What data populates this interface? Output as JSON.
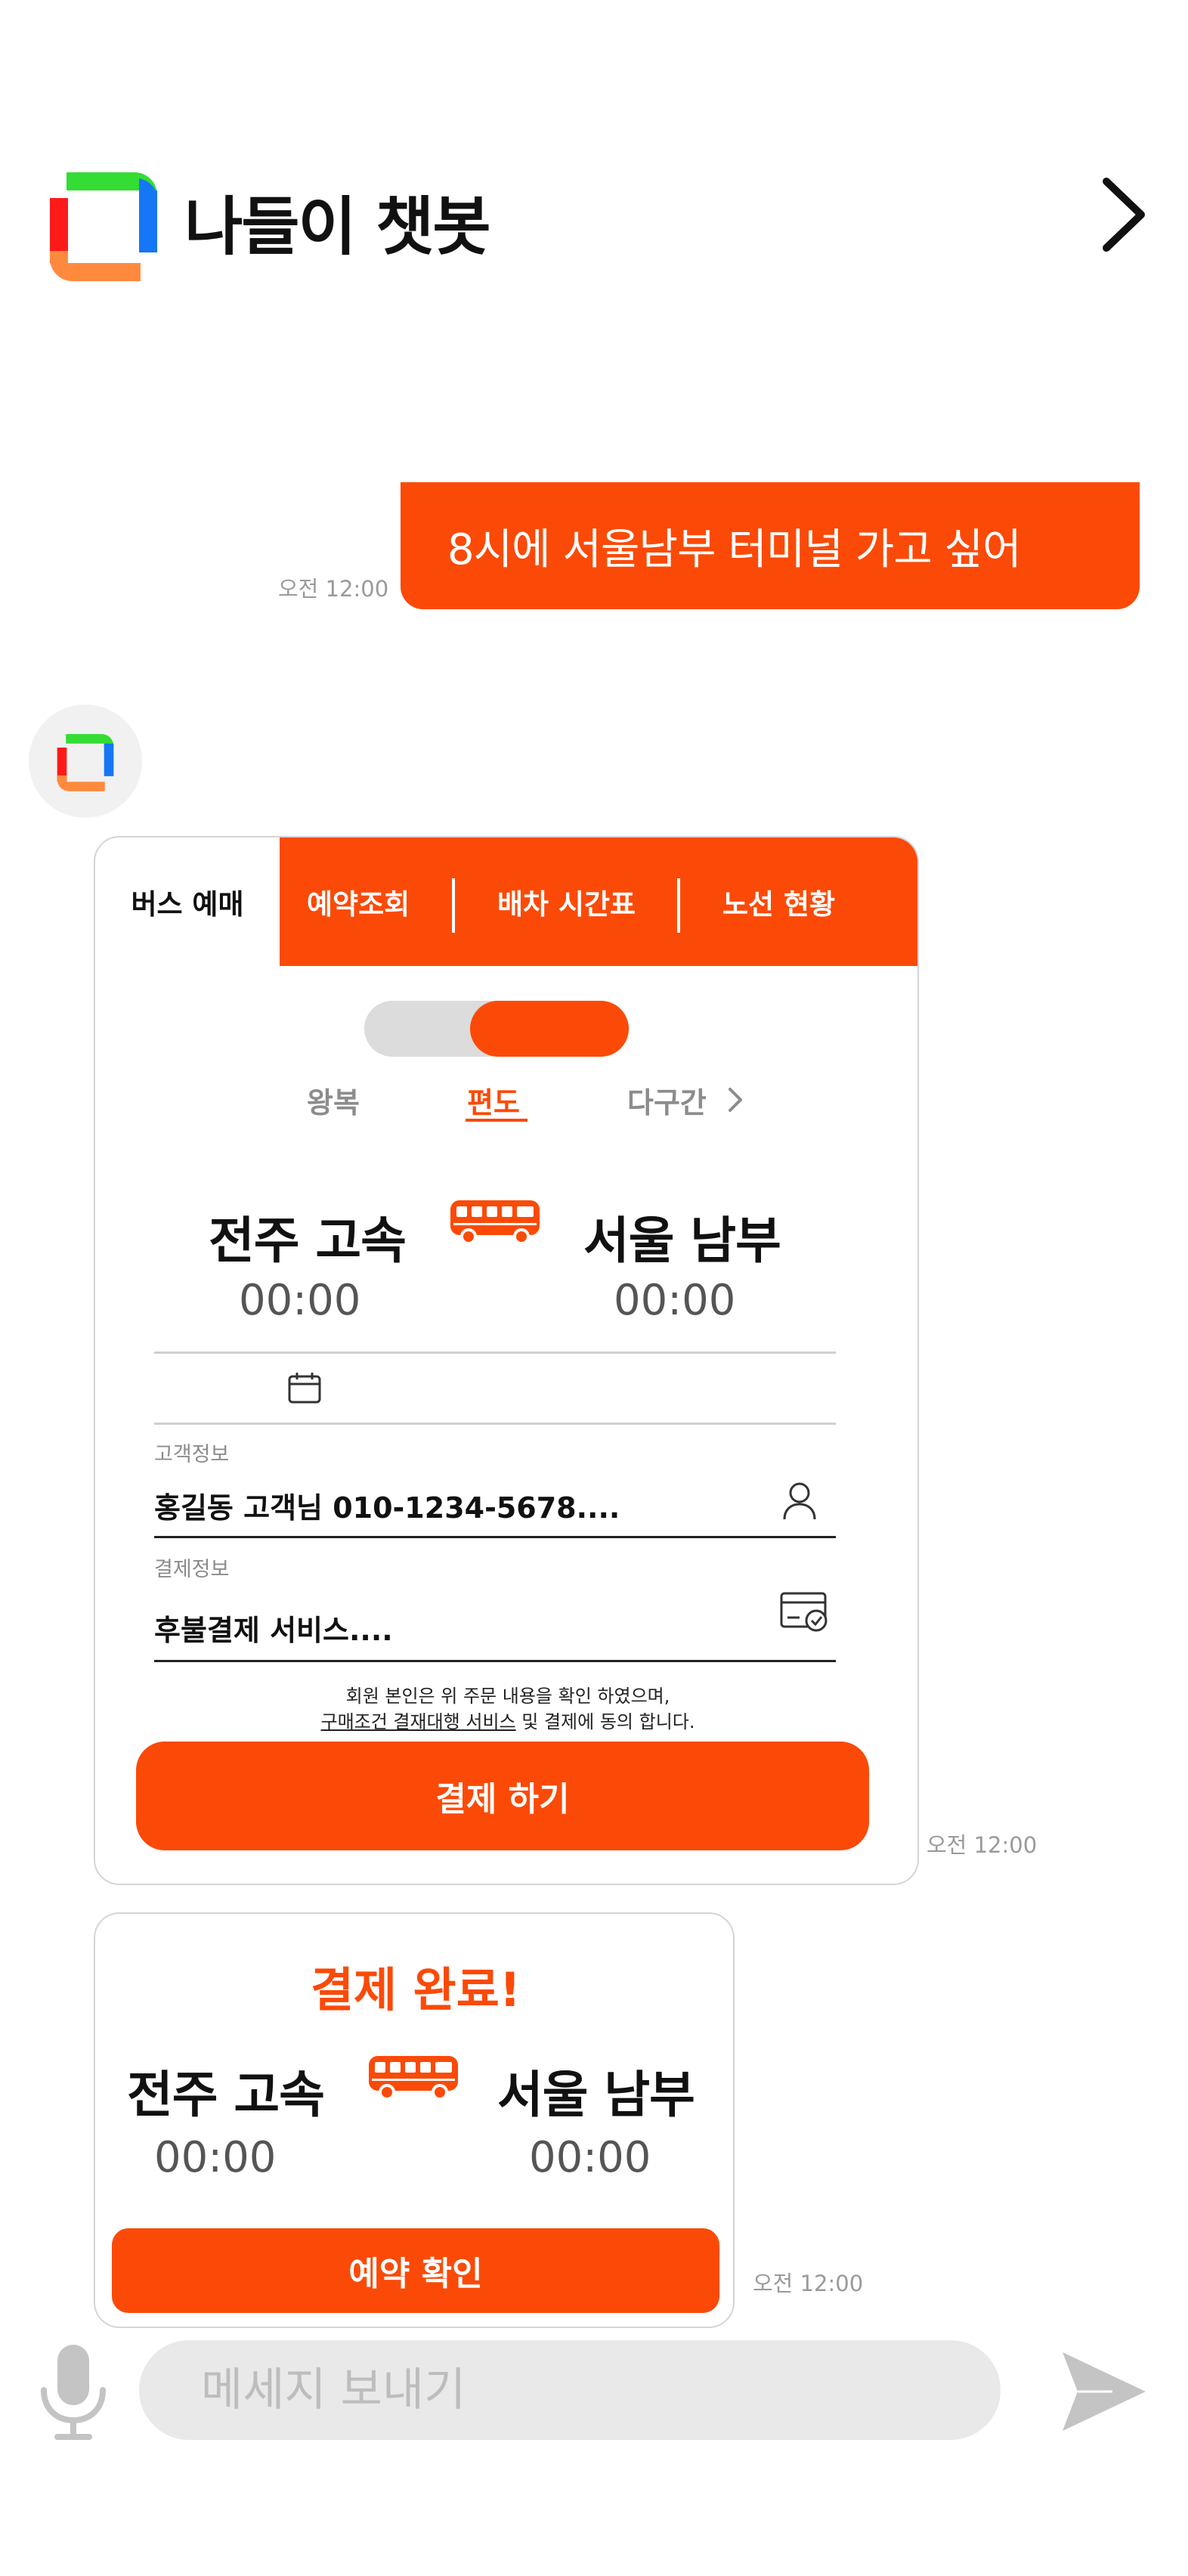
{
  "header": {
    "title": "나들이 챗봇",
    "logo_colors": {
      "green": "#33dd33",
      "blue": "#1577f5",
      "red": "#ff1a1a",
      "orange": "#ff8a3d"
    }
  },
  "theme": {
    "accent": "#fb4a07"
  },
  "chat": {
    "user_message": "8시에 서울남부 터미널 가고 싶어",
    "user_timestamp": "오전 12:00",
    "booking_timestamp": "오전 12:00",
    "complete_timestamp": "오전 12:00"
  },
  "booking_card": {
    "tabs": [
      "버스 예매",
      "예약조회",
      "배차 시간표",
      "노선 현황"
    ],
    "active_tab": "버스 예매",
    "trip_options": [
      "왕복",
      "편도",
      "다구간"
    ],
    "selected_trip": "편도",
    "origin": "전주 고속",
    "destination": "서울 남부",
    "departure_time": "00:00",
    "arrival_time": "00:00",
    "customer_label": "고객정보",
    "customer_value": "홍길동 고객님 010-1234-5678....",
    "payment_label": "결제정보",
    "payment_value": "후불결제 서비스....",
    "notice_line1": "회원 본인은 위 주문 내용을 확인 하였으며,",
    "notice_link": "구매조건 결재대행 서비스",
    "notice_line2_rest": " 및 결제에 동의 합니다.",
    "pay_button": "결제 하기"
  },
  "complete_card": {
    "title": "결제 완료!",
    "origin": "전주 고속",
    "destination": "서울 남부",
    "departure_time": "00:00",
    "arrival_time": "00:00",
    "confirm_button": "예약 확인"
  },
  "input_bar": {
    "placeholder": "메세지 보내기"
  }
}
